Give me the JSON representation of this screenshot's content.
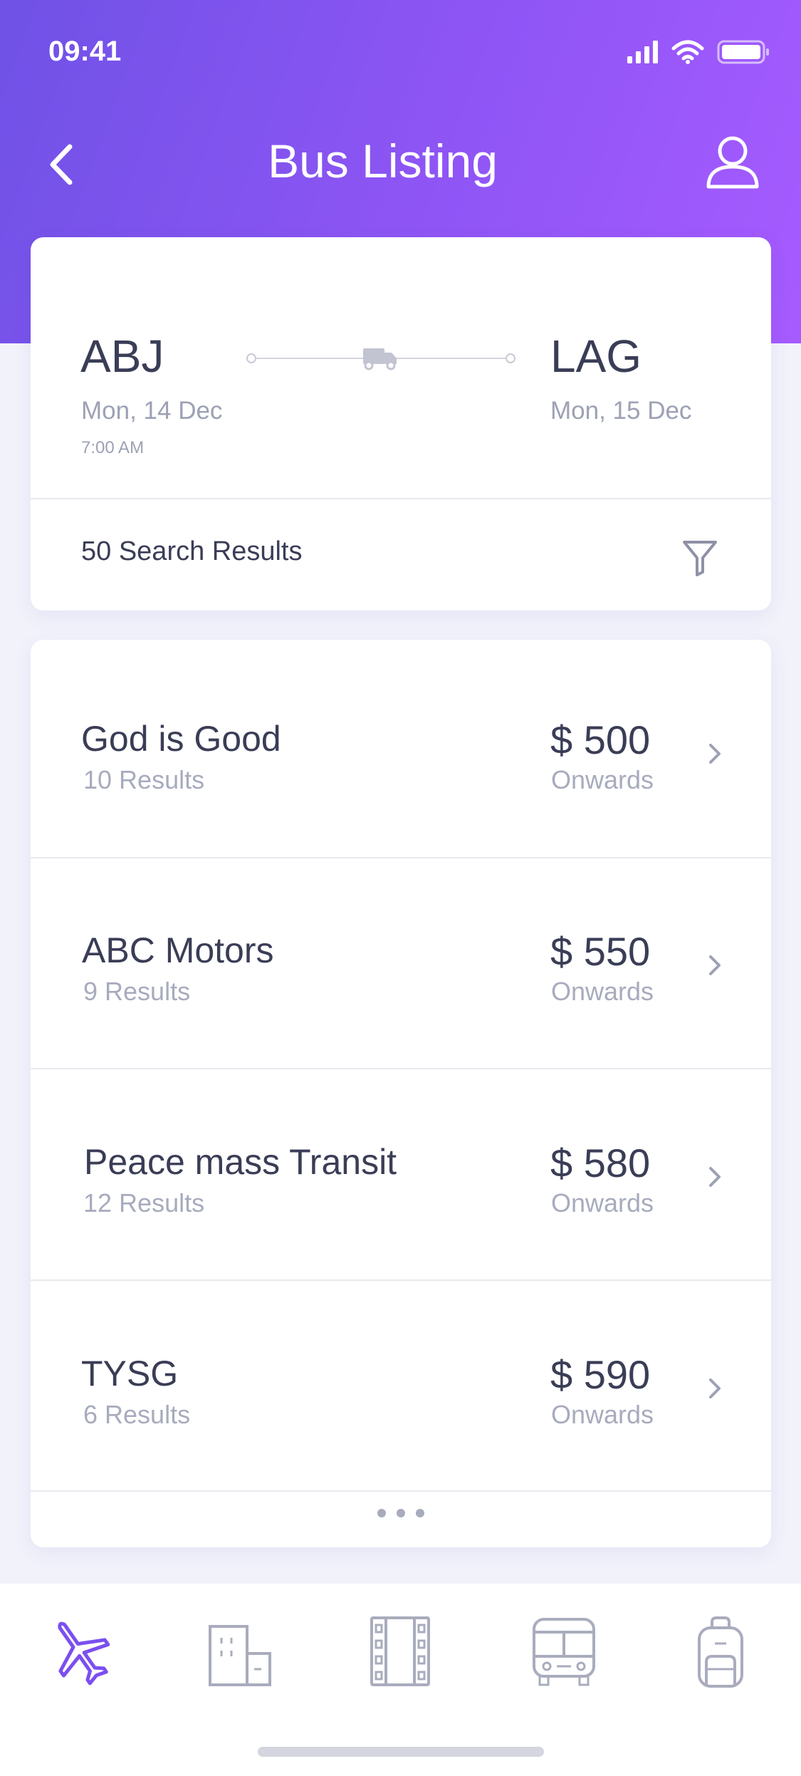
{
  "status_bar": {
    "time": "09:41"
  },
  "header": {
    "title": "Bus Listing"
  },
  "route": {
    "from_code": "ABJ",
    "from_date": "Mon, 14 Dec",
    "from_time": "7:00 AM",
    "to_code": "LAG",
    "to_date": "Mon, 15 Dec"
  },
  "results": {
    "count_label": "50 Search Results"
  },
  "operators": [
    {
      "name": "God is Good",
      "results": "10 Results",
      "price": "$ 500",
      "suffix": "Onwards"
    },
    {
      "name": "ABC Motors",
      "results": "9 Results",
      "price": "$ 550",
      "suffix": "Onwards"
    },
    {
      "name": "Peace mass Transit",
      "results": "12 Results",
      "price": "$ 580",
      "suffix": "Onwards"
    },
    {
      "name": "TYSG",
      "results": "6 Results",
      "price": "$ 590",
      "suffix": "Onwards"
    }
  ],
  "tabs": [
    {
      "icon": "airplane-icon",
      "active": true
    },
    {
      "icon": "hotel-icon",
      "active": false
    },
    {
      "icon": "film-icon",
      "active": false
    },
    {
      "icon": "bus-icon",
      "active": false
    },
    {
      "icon": "backpack-icon",
      "active": false
    }
  ],
  "colors": {
    "header_gradient_start": "#6f52e6",
    "header_gradient_end": "#a65bff",
    "accent": "#7b4ff0",
    "text_primary": "#3a3d56",
    "text_secondary": "#a7abbd",
    "icon_inactive": "#a9acbd"
  }
}
